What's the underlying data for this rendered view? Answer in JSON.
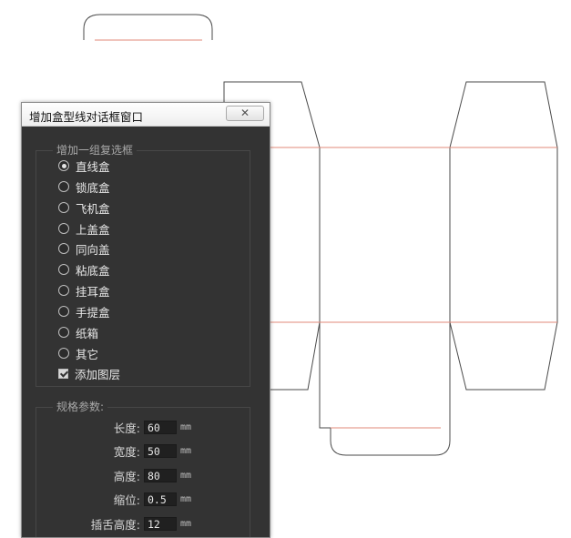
{
  "dialog": {
    "title": "增加盒型线对话框窗口",
    "close_icon": "close-x-icon",
    "box_types": {
      "legend": "增加一组复选框",
      "options": [
        {
          "label": "直线盒",
          "selected": true
        },
        {
          "label": "锁底盒",
          "selected": false
        },
        {
          "label": "飞机盒",
          "selected": false
        },
        {
          "label": "上盖盒",
          "selected": false
        },
        {
          "label": "同向盖",
          "selected": false
        },
        {
          "label": "粘底盒",
          "selected": false
        },
        {
          "label": "挂耳盒",
          "selected": false
        },
        {
          "label": "手提盒",
          "selected": false
        },
        {
          "label": "纸箱",
          "selected": false
        },
        {
          "label": "其它",
          "selected": false
        }
      ],
      "add_layer": {
        "label": "添加图层",
        "checked": true
      }
    },
    "params": {
      "legend": "规格参数:",
      "rows": [
        {
          "label": "长度:",
          "value": "60",
          "unit": "mm"
        },
        {
          "label": "宽度:",
          "value": "50",
          "unit": "mm"
        },
        {
          "label": "高度:",
          "value": "80",
          "unit": "mm"
        },
        {
          "label": "缩位:",
          "value": "0.5",
          "unit": "mm"
        },
        {
          "label": "插舌高度:",
          "value": "12",
          "unit": "mm"
        }
      ]
    }
  },
  "colors": {
    "cut_line": "#4a4a4a",
    "fold_line": "#e08a7a",
    "dialog_bg": "#333333"
  }
}
